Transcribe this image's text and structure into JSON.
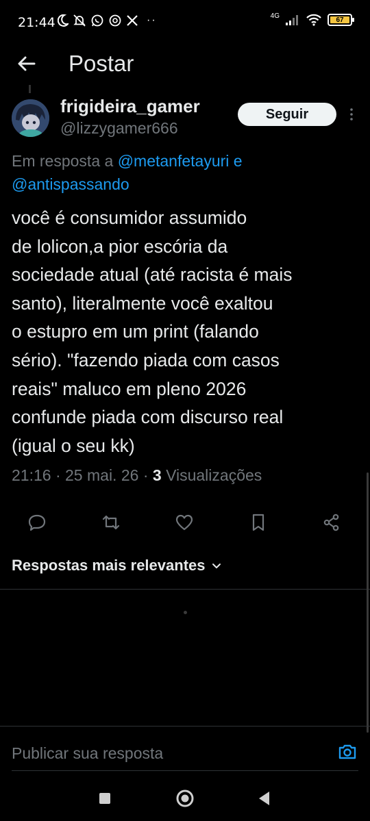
{
  "status_bar": {
    "time": "21:44",
    "left_icons": [
      "moon-icon",
      "bell-off-icon",
      "whatsapp-icon",
      "threads-icon",
      "x-icon"
    ],
    "more_dots": "··",
    "network": "4G",
    "battery_level": "67"
  },
  "header": {
    "title": "Postar"
  },
  "post": {
    "author_name": "frigideira_gamer",
    "author_handle": "@lizzygamer666",
    "follow_label": "Seguir",
    "reply_prefix": "Em resposta a",
    "reply_mention_1": "@metanfetayuri",
    "reply_joiner": "e",
    "reply_mention_2": "@antispassando",
    "text_lines": [
      "você é consumidor assumido",
      "de lolicon,a pior escória da",
      "sociedade atual (até racista é mais",
      "santo), literalmente você exaltou",
      "o estupro em um print (falando",
      "sério). \"fazendo piada com casos",
      "reais\" maluco em pleno 2026",
      "confunde piada com discurso real",
      "(igual o seu kk)"
    ],
    "time": "21:16",
    "date": "25 mai. 26",
    "views_count": "3",
    "views_label": "Visualizações"
  },
  "actions": [
    "reply-icon",
    "repost-icon",
    "like-icon",
    "bookmark-icon",
    "share-icon"
  ],
  "sort": {
    "label": "Respostas mais relevantes"
  },
  "composer": {
    "placeholder": "Publicar sua resposta"
  },
  "colors": {
    "background": "#000000",
    "text": "#e7e9ea",
    "muted": "#71767b",
    "accent": "#1d9bf0",
    "follow_bg": "#eff3f4",
    "battery": "#f4c542"
  }
}
